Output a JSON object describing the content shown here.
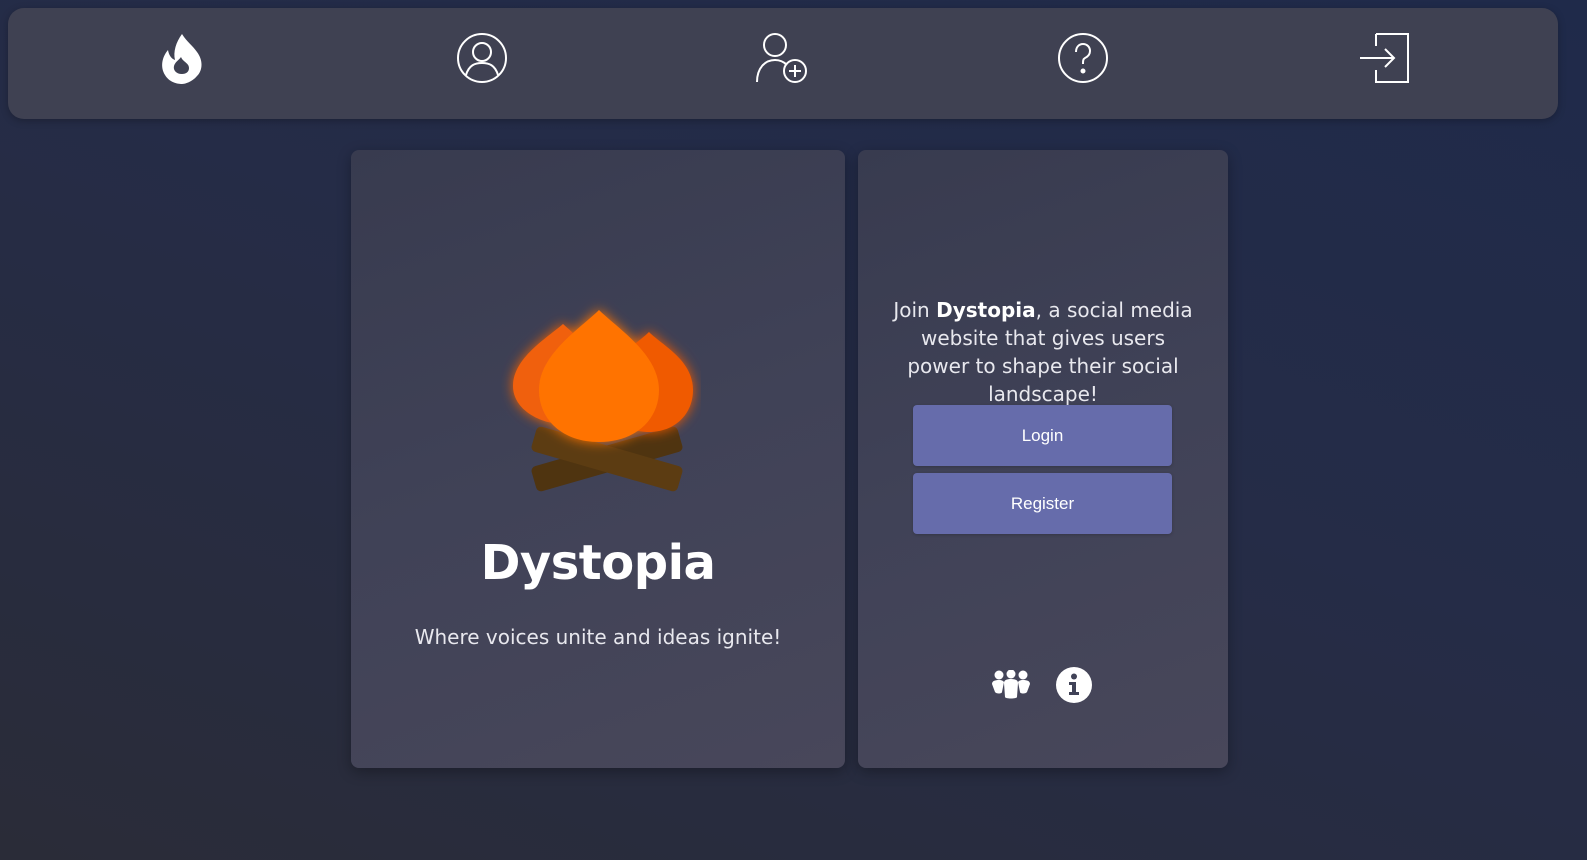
{
  "nav": {
    "items": [
      {
        "name": "home",
        "icon": "flame-icon"
      },
      {
        "name": "profile",
        "icon": "user-circle-icon"
      },
      {
        "name": "add-user",
        "icon": "user-plus-icon"
      },
      {
        "name": "help",
        "icon": "question-circle-icon"
      },
      {
        "name": "login",
        "icon": "sign-in-icon"
      }
    ]
  },
  "brand": {
    "title": "Dystopia",
    "tagline": "Where voices unite and ideas ignite!",
    "logo_icon": "campfire-icon"
  },
  "intro": {
    "prefix": "Join ",
    "brand": "Dystopia",
    "suffix": ", a social media website that gives users power to shape their social landscape!"
  },
  "actions": {
    "login_label": "Login",
    "register_label": "Register"
  },
  "footer": {
    "icons": [
      "users-icon",
      "info-icon"
    ]
  },
  "colors": {
    "background": "#252c47",
    "navbar": "#3f4152",
    "card": "#404257",
    "button": "#666cab",
    "flame": "#ff7300",
    "log": "#5a3a10"
  }
}
